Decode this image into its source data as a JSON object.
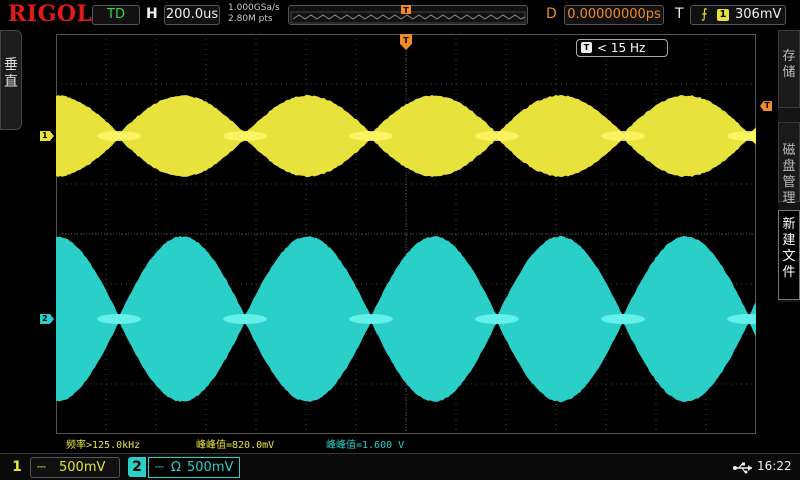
{
  "topbar": {
    "brand": "RIGOL",
    "run_mode": "TD",
    "timebase_label": "H",
    "timebase": "200.0us",
    "sample_rate": "1.000GSa/s",
    "memory_depth": "2.80M pts",
    "delay_label": "D",
    "delay": "0.00000000ps",
    "trigger_label": "T",
    "trigger_slope_icon": "rising-edge-icon",
    "trigger_source": "1",
    "trigger_level": "306mV"
  },
  "left_tab": {
    "chars": [
      "垂",
      "直"
    ]
  },
  "right_tabs": {
    "save": [
      "存",
      "储"
    ],
    "disk": [
      "磁",
      "盘",
      "管",
      "理"
    ],
    "new_file": [
      "新",
      "建",
      "文",
      "件"
    ]
  },
  "markers": {
    "ch1": "1",
    "ch2": "2",
    "trigger_level": "T",
    "trigger_position": "T"
  },
  "freq_counter": {
    "icon": "T",
    "value": "< 15 Hz"
  },
  "measurements": {
    "frequency": "频率>125.0kHz",
    "vpp_ch1": "峰峰值=820.0mV",
    "vpp_ch2": "峰峰值=1.600 V"
  },
  "bottombar": {
    "ch1_number": "1",
    "ch1_coupling": "⎓",
    "ch1_scale": "500mV",
    "ch2_number": "2",
    "ch2_coupling": "⎓",
    "ch2_impedance": "Ω",
    "ch2_scale": "500mV",
    "clock": "16:22"
  },
  "colors": {
    "ch1": "#e8e33c",
    "ch2": "#2ad0c8",
    "trigger": "#f08a2a",
    "brand": "#e21a1a",
    "run_mode": "#41d33d"
  }
}
